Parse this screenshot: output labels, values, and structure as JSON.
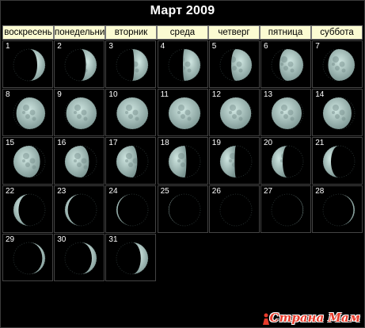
{
  "title": "Март 2009",
  "weekdays": [
    "воскресень",
    "понедельни",
    "вторник",
    "среда",
    "четверг",
    "пятница",
    "суббота"
  ],
  "days": [
    {
      "n": "1",
      "illum": 0.25,
      "waxing": true
    },
    {
      "n": "2",
      "illum": 0.34,
      "waxing": true
    },
    {
      "n": "3",
      "illum": 0.44,
      "waxing": true
    },
    {
      "n": "4",
      "illum": 0.55,
      "waxing": true
    },
    {
      "n": "5",
      "illum": 0.65,
      "waxing": true
    },
    {
      "n": "6",
      "illum": 0.75,
      "waxing": true
    },
    {
      "n": "7",
      "illum": 0.84,
      "waxing": true
    },
    {
      "n": "8",
      "illum": 0.91,
      "waxing": true
    },
    {
      "n": "9",
      "illum": 0.96,
      "waxing": true
    },
    {
      "n": "10",
      "illum": 0.99,
      "waxing": true
    },
    {
      "n": "11",
      "illum": 1.0,
      "waxing": true
    },
    {
      "n": "12",
      "illum": 0.98,
      "waxing": false
    },
    {
      "n": "13",
      "illum": 0.95,
      "waxing": false
    },
    {
      "n": "14",
      "illum": 0.9,
      "waxing": false
    },
    {
      "n": "15",
      "illum": 0.84,
      "waxing": false
    },
    {
      "n": "16",
      "illum": 0.76,
      "waxing": false
    },
    {
      "n": "17",
      "illum": 0.66,
      "waxing": false
    },
    {
      "n": "18",
      "illum": 0.56,
      "waxing": false
    },
    {
      "n": "19",
      "illum": 0.46,
      "waxing": false
    },
    {
      "n": "20",
      "illum": 0.35,
      "waxing": false
    },
    {
      "n": "21",
      "illum": 0.25,
      "waxing": false
    },
    {
      "n": "22",
      "illum": 0.16,
      "waxing": false
    },
    {
      "n": "23",
      "illum": 0.09,
      "waxing": false
    },
    {
      "n": "24",
      "illum": 0.04,
      "waxing": false
    },
    {
      "n": "25",
      "illum": 0.01,
      "waxing": false
    },
    {
      "n": "26",
      "illum": 0.0,
      "waxing": true
    },
    {
      "n": "27",
      "illum": 0.01,
      "waxing": true
    },
    {
      "n": "28",
      "illum": 0.04,
      "waxing": true
    },
    {
      "n": "29",
      "illum": 0.09,
      "waxing": true
    },
    {
      "n": "30",
      "illum": 0.15,
      "waxing": true
    },
    {
      "n": "31",
      "illum": 0.23,
      "waxing": true
    }
  ],
  "watermark": "Страна Мам",
  "colors": {
    "header_bg": "#fbfbd2",
    "moon_lit": "#cfe6e1",
    "moon_shadow": "#7b9592",
    "watermark": "#e83b2b"
  }
}
